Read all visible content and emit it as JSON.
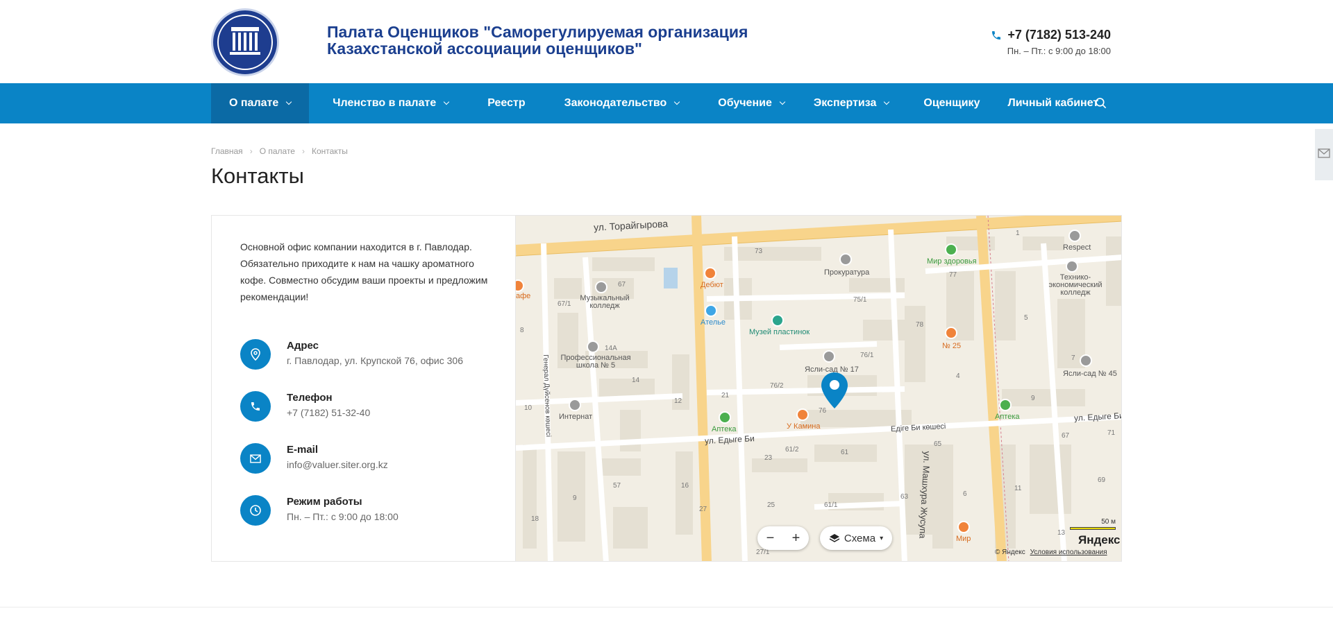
{
  "header": {
    "site_title": "Палата Оценщиков \"Саморегулируемая организация Казахстанской ассоциации оценщиков\"",
    "phone": "+7 (7182) 513-240",
    "hours": "Пн. – Пт.: с 9:00 до 18:00"
  },
  "nav": {
    "items": [
      {
        "label": "О палате",
        "dropdown": true
      },
      {
        "label": "Членство в палате",
        "dropdown": true
      },
      {
        "label": "Реестр",
        "dropdown": false
      },
      {
        "label": "Законодательство",
        "dropdown": true
      },
      {
        "label": "Обучение",
        "dropdown": true
      },
      {
        "label": "Экспертиза",
        "dropdown": true
      },
      {
        "label": "Оценщику",
        "dropdown": false
      },
      {
        "label": "Личный кабинет",
        "dropdown": false
      }
    ]
  },
  "breadcrumb": [
    "Главная",
    "О палате",
    "Контакты"
  ],
  "page_title": "Контакты",
  "contacts": {
    "intro": "Основной офис компании находится в г. Павлодар. Обязательно приходите к нам на чашку ароматного кофе. Совместно обсудим ваши проекты и предложим рекомендации!",
    "address_label": "Адрес",
    "address_value": "г. Павлодар, ул. Крупской 76, офис 306",
    "phone_label": "Телефон",
    "phone_value": "+7 (7182) 51-32-40",
    "email_label": "E-mail",
    "email_value": "info@valuer.siter.org.kz",
    "hours_label": "Режим работы",
    "hours_value": "Пн. – Пт.: с 9:00 до 18:00"
  },
  "map": {
    "streets": {
      "toraigyrov": "ул. Торайгырова",
      "edyge_bi": "ул. Едыге Би",
      "edige_bi_koshesi": "Едіге Би көшесі",
      "edyge_bi_right": "ул. Едыге Би",
      "mashhur": "ул. Машхура Жусупа",
      "general": "Генерал Дүйсенов көшесі"
    },
    "pois": {
      "debut": "Дебют",
      "atelier": "Ателье",
      "music_college": "Музыкальный колледж",
      "prof_school": "Профессиональная школа № 5",
      "internat": "Интернат",
      "prokuratura": "Прокуратура",
      "museum": "Музей пластинок",
      "mir_zdorovya": "Мир здоровья",
      "no25": "№ 25",
      "yasli17": "Ясли-сад № 17",
      "u_kamina": "У Камина",
      "apteka1": "Аптека",
      "apteka2": "Аптека",
      "respect": "Respect",
      "tech_college": "Технико-экономический колледж",
      "yasli45": "Ясли-сад № 45",
      "mir": "Мир",
      "cafe": "афе"
    },
    "house_numbers": [
      "73",
      "67",
      "67/1",
      "8",
      "14А",
      "14",
      "12",
      "10",
      "21",
      "76/2",
      "76/1",
      "75/1",
      "78",
      "76",
      "4",
      "77",
      "1",
      "5",
      "7",
      "9",
      "67",
      "71",
      "65",
      "61/2",
      "61",
      "23",
      "57",
      "16",
      "9",
      "18",
      "27",
      "25",
      "61/1",
      "63",
      "6",
      "11",
      "13",
      "69",
      "27/1"
    ],
    "scheme_label": "Схема",
    "zoom_out": "−",
    "zoom_in": "+",
    "scale": "50 м",
    "logo": "Яндекс",
    "copyright": "© Яндекс",
    "terms": "Условия использования"
  }
}
